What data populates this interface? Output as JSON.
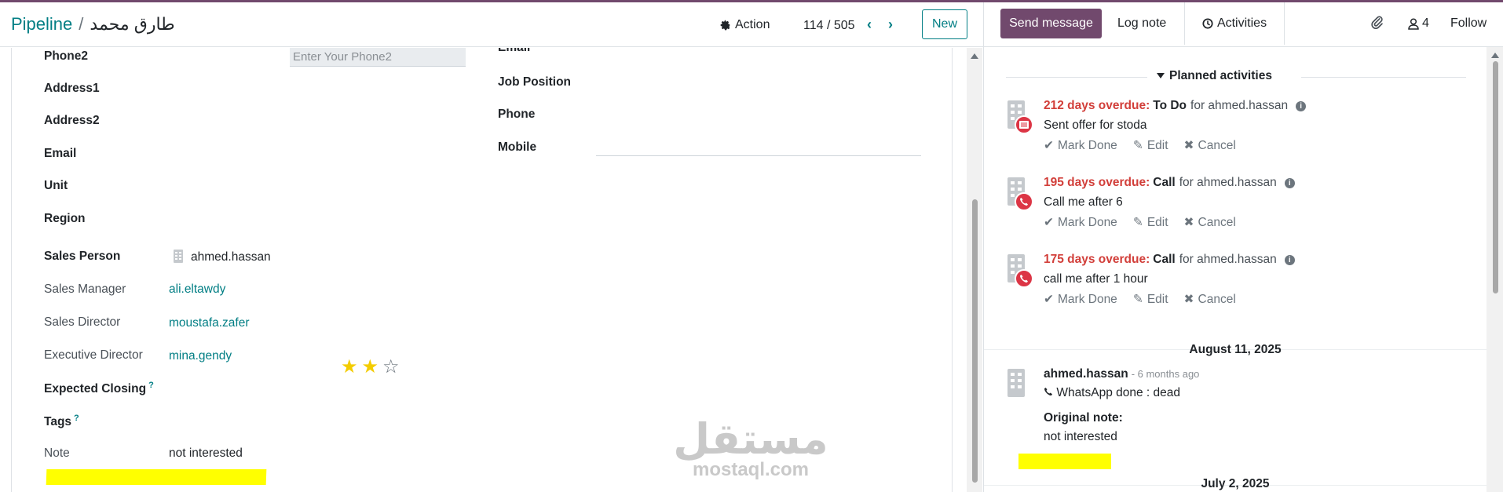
{
  "header": {
    "breadcrumb_parent": "Pipeline",
    "breadcrumb_separator": "/",
    "record_name": "طارق محمد",
    "action_label": "Action",
    "pager": "114 / 505",
    "new_label": "New"
  },
  "form": {
    "left_fields": {
      "phone2_label": "Phone2",
      "phone2_placeholder": "Enter Your Phone2",
      "address1_label": "Address1",
      "address2_label": "Address2",
      "email_label": "Email",
      "unit_label": "Unit",
      "region_label": "Region",
      "sales_person_label": "Sales Person",
      "sales_person_value": "ahmed.hassan",
      "sales_manager_label": "Sales Manager",
      "sales_manager_value": "ali.eltawdy",
      "sales_director_label": "Sales Director",
      "sales_director_value": "moustafa.zafer",
      "executive_director_label": "Executive Director",
      "executive_director_value": "mina.gendy",
      "expected_closing_label": "Expected Closing",
      "expected_closing_help": "?",
      "expected_closing_stars": 2,
      "expected_closing_max": 3,
      "tags_label": "Tags",
      "tags_help": "?",
      "note_label": "Note",
      "note_value": "not interested"
    },
    "right_fields": {
      "email_label": "Email",
      "job_position_label": "Job Position",
      "phone_label": "Phone",
      "mobile_label": "Mobile"
    }
  },
  "watermark": {
    "arabic": "مستقل",
    "latin": "mostaql.com"
  },
  "chatter": {
    "send_message_label": "Send message",
    "log_note_label": "Log note",
    "activities_label": "Activities",
    "followers_count": "4",
    "follow_label": "Follow",
    "planned_activities_label": "Planned activities",
    "activities": [
      {
        "overdue": "212 days overdue:",
        "type": "To Do",
        "for_text": "for ahmed.hassan",
        "summary": "Sent offer for stoda",
        "badge_icon": "todo-icon"
      },
      {
        "overdue": "195 days overdue:",
        "type": "Call",
        "for_text": "for ahmed.hassan",
        "summary": "Call me after 6",
        "badge_icon": "phone-icon"
      },
      {
        "overdue": "175 days overdue:",
        "type": "Call",
        "for_text": "for ahmed.hassan",
        "summary": "call me after 1 hour",
        "badge_icon": "phone-icon"
      }
    ],
    "activity_buttons": {
      "mark_done": "Mark Done",
      "edit": "Edit",
      "cancel": "Cancel"
    },
    "date_separator_1": "August 11, 2025",
    "message": {
      "author": "ahmed.hassan",
      "ago": "- 6 months ago",
      "line": "WhatsApp done : dead",
      "original_label": "Original note:",
      "original_value": "not interested"
    },
    "date_separator_2": "July 2, 2025"
  },
  "colors": {
    "brand": "#71496d",
    "link": "#017e84",
    "overdue": "#d23f3a",
    "highlight": "#ffff00",
    "star": "#f3cc00"
  }
}
